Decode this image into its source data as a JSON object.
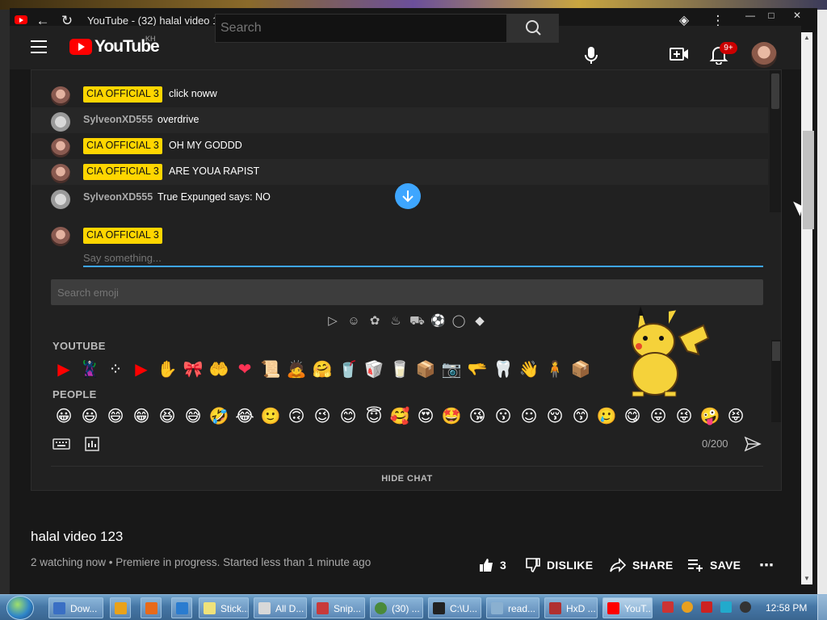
{
  "browser": {
    "tab_title": "YouTube - (32) halal video 123 - YouTube"
  },
  "header": {
    "logo_text": "YouTube",
    "country_code": "KH",
    "search_placeholder": "Search",
    "notification_count": "9+"
  },
  "chat": {
    "messages": [
      {
        "author": "CIA OFFICIAL 3",
        "badge": true,
        "text": "click noww"
      },
      {
        "author": "SylveonXD555",
        "badge": false,
        "text": "overdrive"
      },
      {
        "author": "CIA OFFICIAL 3",
        "badge": true,
        "text": "OH MY GODDD"
      },
      {
        "author": "CIA OFFICIAL 3",
        "badge": true,
        "text": "ARE YOUA RAPIST"
      },
      {
        "author": "SylveonXD555",
        "badge": false,
        "text": "True Expunged says: NO"
      }
    ],
    "current_user": "CIA OFFICIAL 3",
    "input_placeholder": "Say something...",
    "emoji_search_placeholder": "Search emoji",
    "section_youtube": "YOUTUBE",
    "section_people": "PEOPLE",
    "youtube_emojis": [
      "▶",
      "🦹",
      "⁘",
      "▶",
      "✋",
      "🎀",
      "🤲",
      "❤",
      "📜",
      "🙇",
      "🤗",
      "🥤",
      "🥡",
      "🥛",
      "📦",
      "📷",
      "🫳",
      "🦷",
      "👋",
      "🧍",
      "📦"
    ],
    "people_emojis": [
      "😀",
      "😃",
      "😄",
      "😁",
      "😆",
      "😅",
      "🤣",
      "😂",
      "🙂",
      "🙃",
      "😉",
      "😊",
      "😇",
      "🥰",
      "😍",
      "🤩",
      "😘",
      "😗",
      "☺",
      "😚",
      "😙",
      "🥲",
      "😋",
      "😛",
      "😜",
      "🤪",
      "😝"
    ],
    "char_counter": "0/200",
    "hide_chat_label": "HIDE CHAT"
  },
  "video": {
    "title": "halal video 123",
    "meta": "2 watching now • Premiere in progress. Started less than 1 minute ago",
    "like_count": "3",
    "dislike_label": "DISLIKE",
    "share_label": "SHARE",
    "save_label": "SAVE"
  },
  "taskbar": {
    "items": [
      "Dow...",
      "",
      "",
      "",
      "Stick...",
      "All D...",
      "Snip...",
      "(30) ...",
      "C:\\U...",
      "read...",
      "HxD ...",
      "YouT..."
    ],
    "clock": "12:58 PM"
  },
  "colors": {
    "accent_blue": "#3ea6ff",
    "badge_yellow": "#ffd600",
    "youtube_red": "#ff0000"
  }
}
